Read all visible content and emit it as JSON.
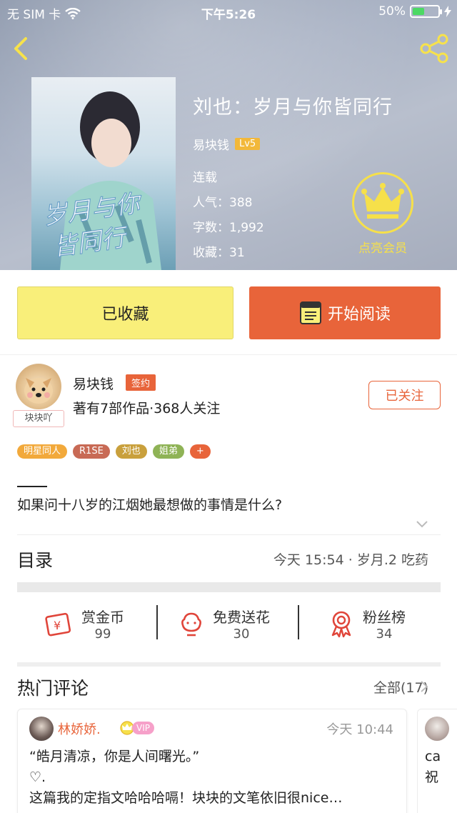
{
  "status_bar": {
    "carrier": "无 SIM 卡",
    "time": "下午5:26",
    "battery": "50%",
    "battery_level": 0.5
  },
  "book": {
    "cover_text": "岁月与你皆同行",
    "title": "刘也：岁月与你皆同行",
    "author": "易块钱",
    "author_level": "Lv5",
    "status": "连载",
    "popularity": "人气：388",
    "word_count": "字数：1,992",
    "favorites": "收藏：31"
  },
  "vip": {
    "label": "点亮会员"
  },
  "actions": {
    "collected_label": "已收藏",
    "read_label": "开始阅读"
  },
  "author_card": {
    "name": "易块钱",
    "badge": "签约",
    "avatar_tag": "块块吖",
    "stats": "著有7部作品·368人关注",
    "follow_label": "已关注"
  },
  "tags": [
    {
      "label": "明星同人",
      "color": "#f2a93b"
    },
    {
      "label": "R1SE",
      "color": "#c86a55"
    },
    {
      "label": "刘也",
      "color": "#c9a03c"
    },
    {
      "label": "姐弟",
      "color": "#8fb356"
    },
    {
      "label": "+",
      "color": "#e8643a"
    }
  ],
  "summary": "如果问十八岁的江烟她最想做的事情是什么?",
  "toc": {
    "title": "目录",
    "latest": "今天 15:54 · 岁月.2 吃药"
  },
  "stats": [
    {
      "label": "赏金币",
      "value": "99",
      "icon": "reward-coin-icon"
    },
    {
      "label": "免费送花",
      "value": "30",
      "icon": "flower-icon"
    },
    {
      "label": "粉丝榜",
      "value": "34",
      "icon": "fan-ranking-icon"
    }
  ],
  "comments": {
    "title": "热门评论",
    "all_label": "全部(17)",
    "items": [
      {
        "user": "林娇娇.",
        "badge": "VIP",
        "time": "今天 10:44",
        "text": "“皓月清凉，你是人间曙光。”\n♡.\n这篇我的定指文哈哈哈嗝！块块的文笔依旧很nice…"
      },
      {
        "text": "ca\n祝"
      }
    ]
  },
  "colors": {
    "accent": "#e8643a",
    "collected_bg": "#f9ef7a",
    "vip_yellow": "#f6e04a"
  }
}
